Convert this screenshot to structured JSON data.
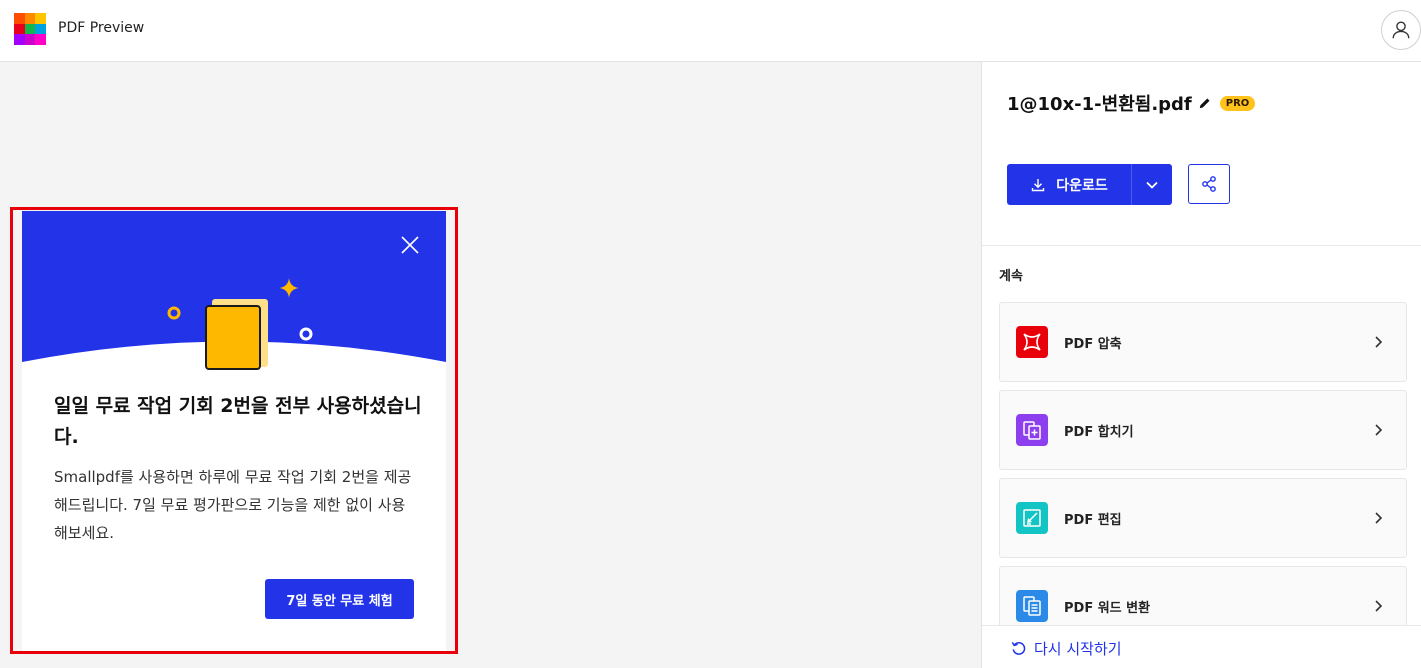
{
  "header": {
    "title": "PDF Preview",
    "logo_colors": [
      "#ff4d00",
      "#ff8a00",
      "#ffc400",
      "#e8001c",
      "#12b84a",
      "#00a3e0",
      "#a100ff",
      "#cc00cc",
      "#ff00c8"
    ],
    "avatar_icon": "user-icon"
  },
  "modal": {
    "title": "일일 무료 작업 기회 2번을 전부 사용하셨습니다.",
    "description": "Smallpdf를 사용하면 하루에 무료 작업 기회 2번을 제공해드립니다. 7일 무료 평가판으로 기능을 제한 없이 사용해보세요.",
    "trial_button": "7일 동안 무료 체험",
    "close_icon": "close-icon",
    "banner_color": "#2233e8",
    "accent_color": "#ffb800"
  },
  "sidebar": {
    "file_name": "1@10x-1-변환됨.pdf",
    "pro_badge": "PRO",
    "download_label": "다운로드",
    "continue_label": "계속",
    "tools": [
      {
        "label": "PDF 압축",
        "icon": "compress-icon",
        "color": "#e8000b"
      },
      {
        "label": "PDF 합치기",
        "icon": "merge-icon",
        "color": "#8d3fef"
      },
      {
        "label": "PDF 편집",
        "icon": "edit-icon",
        "color": "#12c4c4"
      },
      {
        "label": "PDF 워드 변환",
        "icon": "word-convert-icon",
        "color": "#2b8ae8"
      }
    ],
    "restart_label": "다시 시작하기"
  },
  "colors": {
    "brand_blue": "#2233e8",
    "highlight_red": "#e8000b",
    "pro_yellow": "#ffc21a"
  }
}
